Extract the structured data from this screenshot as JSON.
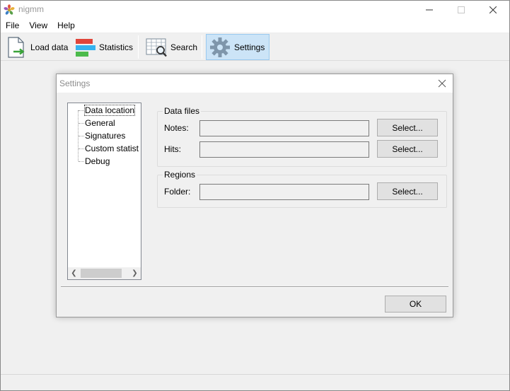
{
  "app": {
    "title": "nigmm"
  },
  "menu": [
    "File",
    "View",
    "Help"
  ],
  "toolbar": {
    "load_data": "Load data",
    "statistics": "Statistics",
    "search": "Search",
    "settings": "Settings"
  },
  "dialog": {
    "title": "Settings",
    "tree": [
      "Data location",
      "General",
      "Signatures",
      "Custom statist",
      "Debug"
    ],
    "data_files": {
      "title": "Data files",
      "notes_label": "Notes:",
      "notes_value": "",
      "hits_label": "Hits:",
      "hits_value": ""
    },
    "regions": {
      "title": "Regions",
      "folder_label": "Folder:",
      "folder_value": ""
    },
    "select_label": "Select...",
    "ok_label": "OK"
  },
  "colors": {
    "accent_selected": "#cce4f7",
    "accent_border": "#99c9ef"
  }
}
